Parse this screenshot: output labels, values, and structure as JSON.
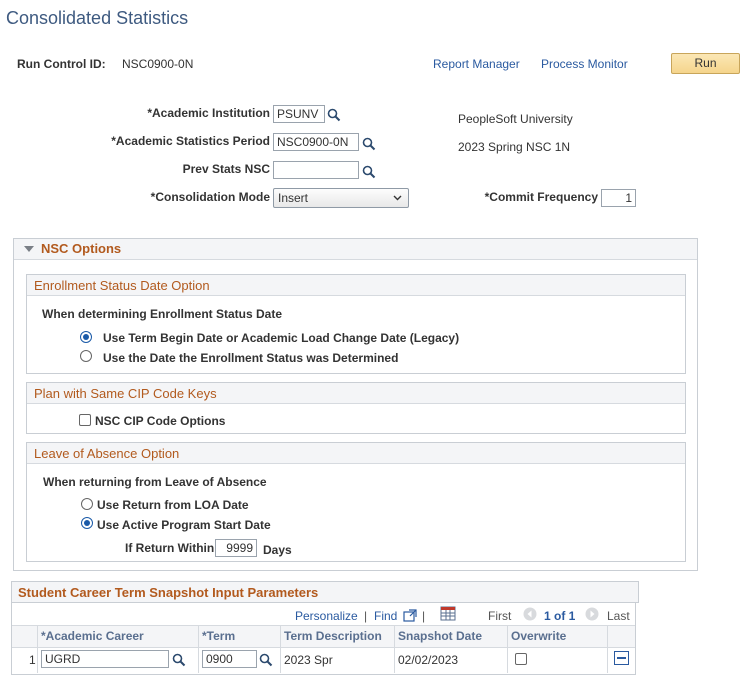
{
  "page": {
    "title": "Consolidated Statistics"
  },
  "run_control": {
    "label": "Run Control ID:",
    "value": "NSC0900-0N"
  },
  "links": {
    "report_manager": "Report Manager",
    "process_monitor": "Process Monitor"
  },
  "run_button": "Run",
  "fields": {
    "academic_institution": {
      "label": "*Academic Institution",
      "value": "PSUNV",
      "description": "PeopleSoft University"
    },
    "academic_statistics_period": {
      "label": "*Academic Statistics Period",
      "value": "NSC0900-0N",
      "description": "2023 Spring NSC 1N"
    },
    "prev_stats_nsc": {
      "label": "Prev Stats NSC",
      "value": ""
    },
    "consolidation_mode": {
      "label": "*Consolidation Mode",
      "value": "Insert"
    },
    "commit_frequency": {
      "label": "*Commit Frequency",
      "value": "1"
    }
  },
  "nsc_options": {
    "title": "NSC Options",
    "enrollment": {
      "title": "Enrollment Status Date Option",
      "prompt": "When determining Enrollment Status Date",
      "options": [
        {
          "label": "Use Term Begin Date or Academic Load Change Date (Legacy)",
          "selected": true
        },
        {
          "label": "Use the Date the Enrollment Status was Determined",
          "selected": false
        }
      ]
    },
    "cip": {
      "title": "Plan with Same CIP Code Keys",
      "checkbox_label": "NSC CIP Code Options",
      "checked": false
    },
    "loa": {
      "title": "Leave of Absence Option",
      "prompt": "When returning from Leave of Absence",
      "options": [
        {
          "label": "Use Return from LOA Date",
          "selected": false
        },
        {
          "label": "Use Active Program Start Date",
          "selected": true
        }
      ],
      "return_within_label": "If Return Within",
      "return_within_value": "9999",
      "days_label": "Days"
    }
  },
  "grid": {
    "title": "Student Career Term Snapshot Input Parameters",
    "toolbar": {
      "personalize": "Personalize",
      "separator": "|",
      "find": "Find",
      "first": "First",
      "range": "1 of 1",
      "last": "Last"
    },
    "columns": [
      "*Academic Career",
      "*Term",
      "Term Description",
      "Snapshot Date",
      "Overwrite"
    ],
    "rows": [
      {
        "num": "1",
        "career": "UGRD",
        "term": "0900",
        "term_description": "2023 Spr",
        "snapshot_date": "02/02/2023",
        "overwrite": false
      }
    ]
  },
  "colors": {
    "title": "#3e5a80",
    "section_title": "#b25a1e",
    "link": "#2a5aa0",
    "accent": "#1a5aa8"
  }
}
